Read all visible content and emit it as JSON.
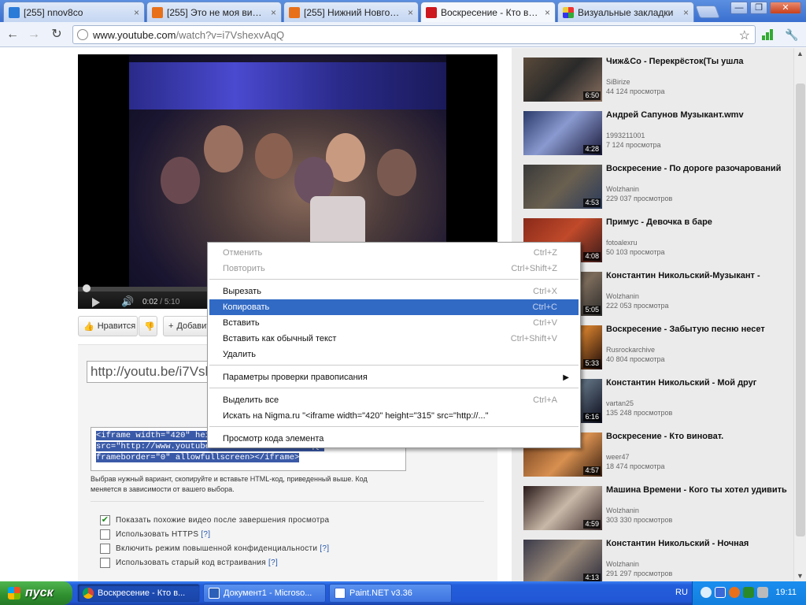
{
  "tabs": [
    {
      "title": "[255] nnov8co",
      "close": "×"
    },
    {
      "title": "[255] Это не моя вина...",
      "close": "×"
    },
    {
      "title": "[255] Нижний Новгород -",
      "close": "×"
    },
    {
      "title": "Воскресение - Кто виноват",
      "close": "×"
    },
    {
      "title": "Визуальные закладки",
      "close": "×"
    }
  ],
  "window_buttons": {
    "minimize": "—",
    "maximize": "❐",
    "close": "✕"
  },
  "toolbar": {
    "back": "←",
    "forward": "→",
    "reload": "↻",
    "url_host": "www.youtube.com",
    "url_path": "/watch?v=i7VshexvAqQ",
    "star": "☆",
    "wrench": "🔧"
  },
  "player": {
    "current_time": "0:02",
    "separator": " / ",
    "total_time": "5:10",
    "volume_icon": "🔊",
    "progress_fraction": 0.006
  },
  "actions": {
    "like": "Нравится",
    "dislike": "",
    "add": "Добавить"
  },
  "share": {
    "short_url": "http://youtu.be/i7Vshe",
    "embed_line1": "<iframe width=\"420\" height=\"315\"",
    "embed_line2": "src=\"http://www.youtube.com/embed/i7VshexvAqQ\"",
    "embed_line3": "frameborder=\"0\" allowfullscreen></iframe>",
    "hint": "Выбрав нужный вариант, скопируйте и вставьте HTML-код, приведенный выше. Код меняется в зависимости от вашего выбора.",
    "options": [
      {
        "label": "Показать похожие видео после завершения просмотра",
        "checked": true,
        "help": ""
      },
      {
        "label": "Использовать HTTPS",
        "checked": false,
        "help": "[?]"
      },
      {
        "label": "Включить режим повышенной конфиденциальности",
        "checked": false,
        "help": "[?]"
      },
      {
        "label": "Использовать старый код встраивания",
        "checked": false,
        "help": "[?]"
      }
    ]
  },
  "related": [
    {
      "title": "Чиж&Co - Перекрёсток(Ты ушла",
      "channel": "SiBirize",
      "views": "44 124 просмотра",
      "duration": "6:50"
    },
    {
      "title": "Андрей Сапунов Музыкант.wmv",
      "channel": "1993211001",
      "views": "7 124 просмотра",
      "duration": "4:28"
    },
    {
      "title": "Воскресение - По дороге разочарований",
      "channel": "Wolzhanin",
      "views": "229 037 просмотров",
      "duration": "4:53"
    },
    {
      "title": "Примус - Девочка в баре",
      "channel": "fotoalexru",
      "views": "50 103 просмотра",
      "duration": "4:08"
    },
    {
      "title": "Константин Никольский-Музыкант -",
      "channel": "Wolzhanin",
      "views": "222 053 просмотра",
      "duration": "5:05"
    },
    {
      "title": "Воскресение - Забытую песню несет",
      "channel": "Rusrockarchive",
      "views": "40 804 просмотра",
      "duration": "5:33"
    },
    {
      "title": "Константин Никольский - Мой друг",
      "channel": "vartan25",
      "views": "135 248 просмотров",
      "duration": "6:16"
    },
    {
      "title": "Воскресение - Кто виноват.",
      "channel": "weer47",
      "views": "18 474 просмотра",
      "duration": "4:57"
    },
    {
      "title": "Машина Времени - Кого ты хотел удивить",
      "channel": "Wolzhanin",
      "views": "303 330 просмотров",
      "duration": "4:59"
    },
    {
      "title": "Константин Никольский - Ночная",
      "channel": "Wolzhanin",
      "views": "291 297 просмотров",
      "duration": "4:13"
    }
  ],
  "context_menu": {
    "undo": {
      "label": "Отменить",
      "shortcut": "Ctrl+Z"
    },
    "redo": {
      "label": "Повторить",
      "shortcut": "Ctrl+Shift+Z"
    },
    "cut": {
      "label": "Вырезать",
      "shortcut": "Ctrl+X"
    },
    "copy": {
      "label": "Копировать",
      "shortcut": "Ctrl+C"
    },
    "paste": {
      "label": "Вставить",
      "shortcut": "Ctrl+V"
    },
    "paste_plain": {
      "label": "Вставить как обычный текст",
      "shortcut": "Ctrl+Shift+V"
    },
    "delete": {
      "label": "Удалить"
    },
    "spellcheck": {
      "label": "Параметры проверки правописания",
      "arrow": "▶"
    },
    "select_all": {
      "label": "Выделить все",
      "shortcut": "Ctrl+A"
    },
    "search": {
      "label": "Искать на Nigma.ru \"<iframe width=\"420\" height=\"315\" src=\"http://...\""
    },
    "inspect": {
      "label": "Просмотр кода элемента"
    }
  },
  "taskbar": {
    "start": "пуск",
    "tasks": [
      {
        "label": "Воскресение - Кто в..."
      },
      {
        "label": "Документ1 - Microso..."
      },
      {
        "label": "Paint.NET v3.36"
      }
    ],
    "lang": "RU",
    "clock": "19:11"
  },
  "colors": {
    "selection": "#316ac5",
    "youtube_red": "#cc181e",
    "xp_blue": "#245edb",
    "start_green": "#2f8f2f"
  }
}
